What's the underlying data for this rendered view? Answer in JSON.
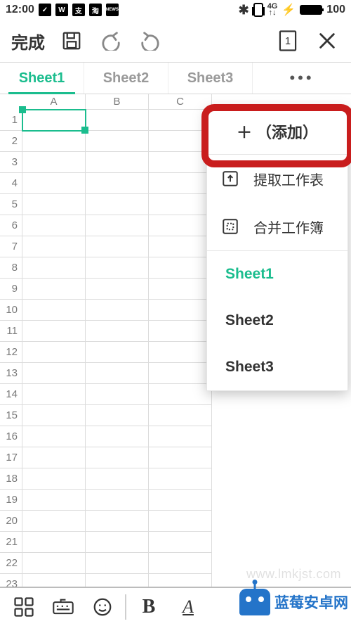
{
  "status": {
    "time": "12:00",
    "icons": [
      "✓",
      "W",
      "支",
      "淘",
      "NEWS"
    ],
    "net": "4G",
    "bt": "✱",
    "battery": "100"
  },
  "toolbar": {
    "done": "完成"
  },
  "tabs": {
    "items": [
      "Sheet1",
      "Sheet2",
      "Sheet3"
    ],
    "activeIndex": 0,
    "more": "•••"
  },
  "grid": {
    "cols": [
      "A",
      "B",
      "C"
    ],
    "rowStart": 1,
    "rowEnd": 23,
    "selected": "A1"
  },
  "popup": {
    "add": "＋ （添加）",
    "extract": "提取工作表",
    "merge": "合并工作簿",
    "sheets": [
      "Sheet1",
      "Sheet2",
      "Sheet3"
    ],
    "sheetActive": 0
  },
  "bottom": {
    "bold": "B",
    "underline": "A"
  },
  "branding": {
    "logoText": "蓝莓安卓网",
    "watermark": "www.lmkjst.com"
  }
}
